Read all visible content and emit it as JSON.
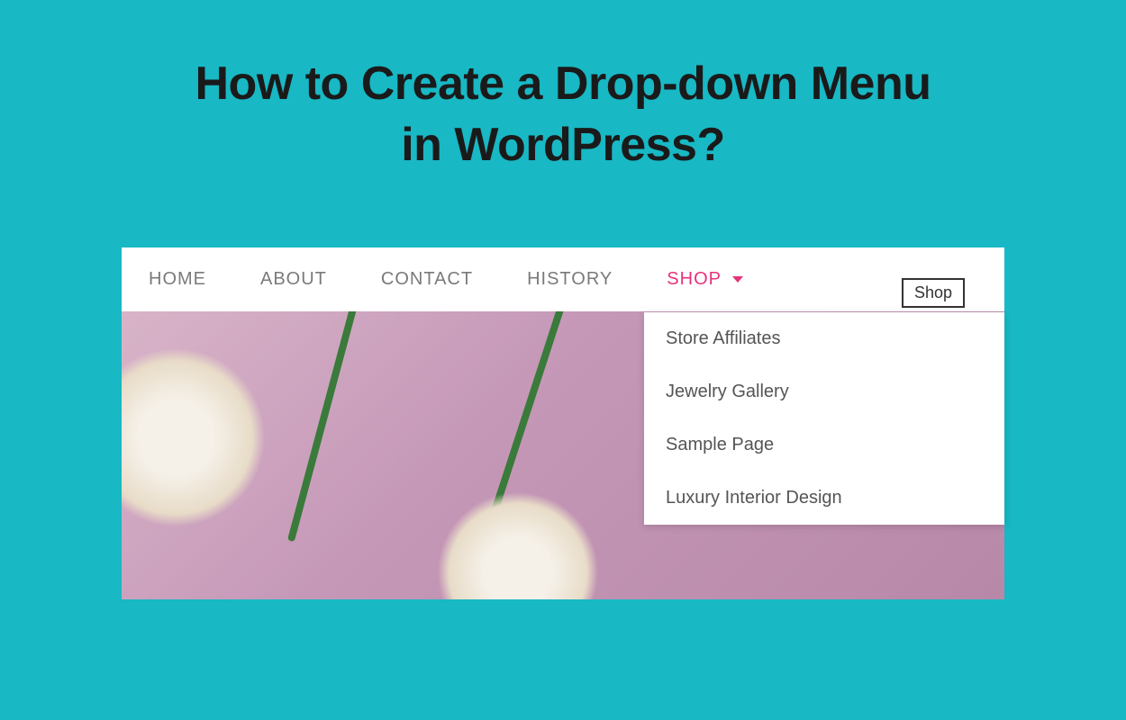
{
  "title": {
    "line1": "How to Create a Drop-down Menu",
    "line2": "in WordPress?"
  },
  "nav": {
    "items": [
      {
        "label": "HOME",
        "active": false
      },
      {
        "label": "ABOUT",
        "active": false
      },
      {
        "label": "CONTACT",
        "active": false
      },
      {
        "label": "HISTORY",
        "active": false
      },
      {
        "label": "SHOP",
        "active": true,
        "has_dropdown": true
      }
    ]
  },
  "dropdown": {
    "tooltip": "Shop",
    "items": [
      "Store Affiliates",
      "Jewelry Gallery",
      "Sample Page",
      "Luxury Interior Design"
    ]
  }
}
